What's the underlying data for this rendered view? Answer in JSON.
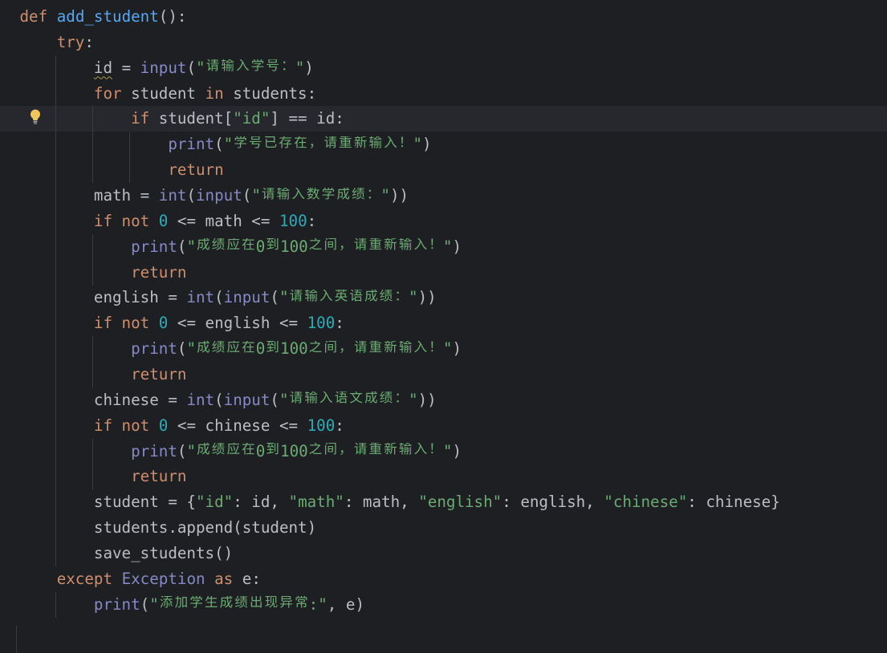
{
  "colors": {
    "background": "#1e1f22",
    "caret_row": "#26282e",
    "text": "#bcbec4",
    "keyword": "#cf8e6d",
    "function": "#56a8f5",
    "builtin": "#8888c6",
    "string": "#6aab73",
    "number": "#2aacb8",
    "indent_guide": "#393b40",
    "weak_warning": "#b09a4d",
    "bulb": "#f2c55c"
  },
  "editor": {
    "caret_line": 5,
    "intention": {
      "line": 5,
      "icon": "lightbulb-icon"
    },
    "lines": [
      {
        "indent": 0,
        "tokens": [
          {
            "text": "def",
            "kind": "kw"
          },
          {
            "text": " ",
            "kind": "txt"
          },
          {
            "text": "add_student",
            "kind": "fn"
          },
          {
            "text": "():",
            "kind": "txt"
          }
        ]
      },
      {
        "indent": 4,
        "tokens": [
          {
            "text": "try",
            "kind": "kw"
          },
          {
            "text": ":",
            "kind": "txt"
          }
        ]
      },
      {
        "indent": 8,
        "tokens": [
          {
            "text": "id",
            "kind": "txt",
            "warn": true
          },
          {
            "text": " = ",
            "kind": "txt"
          },
          {
            "text": "input",
            "kind": "bi"
          },
          {
            "text": "(",
            "kind": "txt"
          },
          {
            "text": "\"请输入学号：\"",
            "kind": "str"
          },
          {
            "text": ")",
            "kind": "txt"
          }
        ]
      },
      {
        "indent": 8,
        "tokens": [
          {
            "text": "for",
            "kind": "kw"
          },
          {
            "text": " student ",
            "kind": "txt"
          },
          {
            "text": "in",
            "kind": "kw"
          },
          {
            "text": " students:",
            "kind": "txt"
          }
        ]
      },
      {
        "indent": 12,
        "tokens": [
          {
            "text": "if",
            "kind": "kw"
          },
          {
            "text": " student[",
            "kind": "txt"
          },
          {
            "text": "\"id\"",
            "kind": "str"
          },
          {
            "text": "] == id:",
            "kind": "txt"
          }
        ]
      },
      {
        "indent": 16,
        "tokens": [
          {
            "text": "print",
            "kind": "bi"
          },
          {
            "text": "(",
            "kind": "txt"
          },
          {
            "text": "\"学号已存在，请重新输入！\"",
            "kind": "str"
          },
          {
            "text": ")",
            "kind": "txt"
          }
        ]
      },
      {
        "indent": 16,
        "tokens": [
          {
            "text": "return",
            "kind": "kw"
          }
        ]
      },
      {
        "indent": 8,
        "tokens": [
          {
            "text": "math = ",
            "kind": "txt"
          },
          {
            "text": "int",
            "kind": "bi"
          },
          {
            "text": "(",
            "kind": "txt"
          },
          {
            "text": "input",
            "kind": "bi"
          },
          {
            "text": "(",
            "kind": "txt"
          },
          {
            "text": "\"请输入数学成绩：\"",
            "kind": "str"
          },
          {
            "text": "))",
            "kind": "txt"
          }
        ]
      },
      {
        "indent": 8,
        "tokens": [
          {
            "text": "if not",
            "kind": "kw"
          },
          {
            "text": " ",
            "kind": "txt"
          },
          {
            "text": "0",
            "kind": "num"
          },
          {
            "text": " <= math <= ",
            "kind": "txt"
          },
          {
            "text": "100",
            "kind": "num"
          },
          {
            "text": ":",
            "kind": "txt"
          }
        ]
      },
      {
        "indent": 12,
        "tokens": [
          {
            "text": "print",
            "kind": "bi"
          },
          {
            "text": "(",
            "kind": "txt"
          },
          {
            "text": "\"成绩应在0到100之间，请重新输入！\"",
            "kind": "str"
          },
          {
            "text": ")",
            "kind": "txt"
          }
        ]
      },
      {
        "indent": 12,
        "tokens": [
          {
            "text": "return",
            "kind": "kw"
          }
        ]
      },
      {
        "indent": 8,
        "tokens": [
          {
            "text": "english = ",
            "kind": "txt"
          },
          {
            "text": "int",
            "kind": "bi"
          },
          {
            "text": "(",
            "kind": "txt"
          },
          {
            "text": "input",
            "kind": "bi"
          },
          {
            "text": "(",
            "kind": "txt"
          },
          {
            "text": "\"请输入英语成绩：\"",
            "kind": "str"
          },
          {
            "text": "))",
            "kind": "txt"
          }
        ]
      },
      {
        "indent": 8,
        "tokens": [
          {
            "text": "if not",
            "kind": "kw"
          },
          {
            "text": " ",
            "kind": "txt"
          },
          {
            "text": "0",
            "kind": "num"
          },
          {
            "text": " <= english <= ",
            "kind": "txt"
          },
          {
            "text": "100",
            "kind": "num"
          },
          {
            "text": ":",
            "kind": "txt"
          }
        ]
      },
      {
        "indent": 12,
        "tokens": [
          {
            "text": "print",
            "kind": "bi"
          },
          {
            "text": "(",
            "kind": "txt"
          },
          {
            "text": "\"成绩应在0到100之间，请重新输入！\"",
            "kind": "str"
          },
          {
            "text": ")",
            "kind": "txt"
          }
        ]
      },
      {
        "indent": 12,
        "tokens": [
          {
            "text": "return",
            "kind": "kw"
          }
        ]
      },
      {
        "indent": 8,
        "tokens": [
          {
            "text": "chinese = ",
            "kind": "txt"
          },
          {
            "text": "int",
            "kind": "bi"
          },
          {
            "text": "(",
            "kind": "txt"
          },
          {
            "text": "input",
            "kind": "bi"
          },
          {
            "text": "(",
            "kind": "txt"
          },
          {
            "text": "\"请输入语文成绩：\"",
            "kind": "str"
          },
          {
            "text": "))",
            "kind": "txt"
          }
        ]
      },
      {
        "indent": 8,
        "tokens": [
          {
            "text": "if not",
            "kind": "kw"
          },
          {
            "text": " ",
            "kind": "txt"
          },
          {
            "text": "0",
            "kind": "num"
          },
          {
            "text": " <= chinese <= ",
            "kind": "txt"
          },
          {
            "text": "100",
            "kind": "num"
          },
          {
            "text": ":",
            "kind": "txt"
          }
        ]
      },
      {
        "indent": 12,
        "tokens": [
          {
            "text": "print",
            "kind": "bi"
          },
          {
            "text": "(",
            "kind": "txt"
          },
          {
            "text": "\"成绩应在0到100之间，请重新输入！\"",
            "kind": "str"
          },
          {
            "text": ")",
            "kind": "txt"
          }
        ]
      },
      {
        "indent": 12,
        "tokens": [
          {
            "text": "return",
            "kind": "kw"
          }
        ]
      },
      {
        "indent": 8,
        "tokens": [
          {
            "text": "student = {",
            "kind": "txt"
          },
          {
            "text": "\"id\"",
            "kind": "str"
          },
          {
            "text": ": id, ",
            "kind": "txt"
          },
          {
            "text": "\"math\"",
            "kind": "str"
          },
          {
            "text": ": math, ",
            "kind": "txt"
          },
          {
            "text": "\"english\"",
            "kind": "str"
          },
          {
            "text": ": english, ",
            "kind": "txt"
          },
          {
            "text": "\"chinese\"",
            "kind": "str"
          },
          {
            "text": ": chinese}",
            "kind": "txt"
          }
        ]
      },
      {
        "indent": 8,
        "tokens": [
          {
            "text": "students.append(student)",
            "kind": "txt"
          }
        ]
      },
      {
        "indent": 8,
        "tokens": [
          {
            "text": "save_students()",
            "kind": "txt"
          }
        ]
      },
      {
        "indent": 4,
        "tokens": [
          {
            "text": "except",
            "kind": "kw"
          },
          {
            "text": " ",
            "kind": "txt"
          },
          {
            "text": "Exception",
            "kind": "bi"
          },
          {
            "text": " ",
            "kind": "txt"
          },
          {
            "text": "as",
            "kind": "kw"
          },
          {
            "text": " e:",
            "kind": "txt"
          }
        ]
      },
      {
        "indent": 8,
        "tokens": [
          {
            "text": "print",
            "kind": "bi"
          },
          {
            "text": "(",
            "kind": "txt"
          },
          {
            "text": "\"添加学生成绩出现异常:\"",
            "kind": "str"
          },
          {
            "text": ", e)",
            "kind": "txt"
          }
        ]
      }
    ]
  }
}
